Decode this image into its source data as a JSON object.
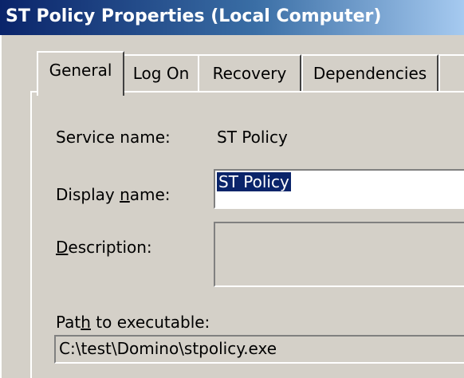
{
  "window": {
    "title": "ST Policy Properties (Local Computer)"
  },
  "tabs": [
    {
      "label": "General",
      "selected": true
    },
    {
      "label": "Log On",
      "selected": false
    },
    {
      "label": "Recovery",
      "selected": false
    },
    {
      "label": "Dependencies",
      "selected": false
    }
  ],
  "general": {
    "service_name_label": "Service name:",
    "service_name_value": "ST Policy",
    "display_name_label_pre": "Display ",
    "display_name_label_accel": "n",
    "display_name_label_post": "ame:",
    "display_name_value": "ST Policy",
    "description_label_accel": "D",
    "description_label_post": "escription:",
    "description_value": "",
    "path_label_pre": "Pat",
    "path_label_accel": "h",
    "path_label_post": " to executable:",
    "path_value": "C:\\test\\Domino\\stpolicy.exe"
  },
  "colors": {
    "title_gradient_start": "#0a246a",
    "title_gradient_end": "#a6caf0",
    "face": "#d4d0c8",
    "selection": "#0a246a"
  }
}
